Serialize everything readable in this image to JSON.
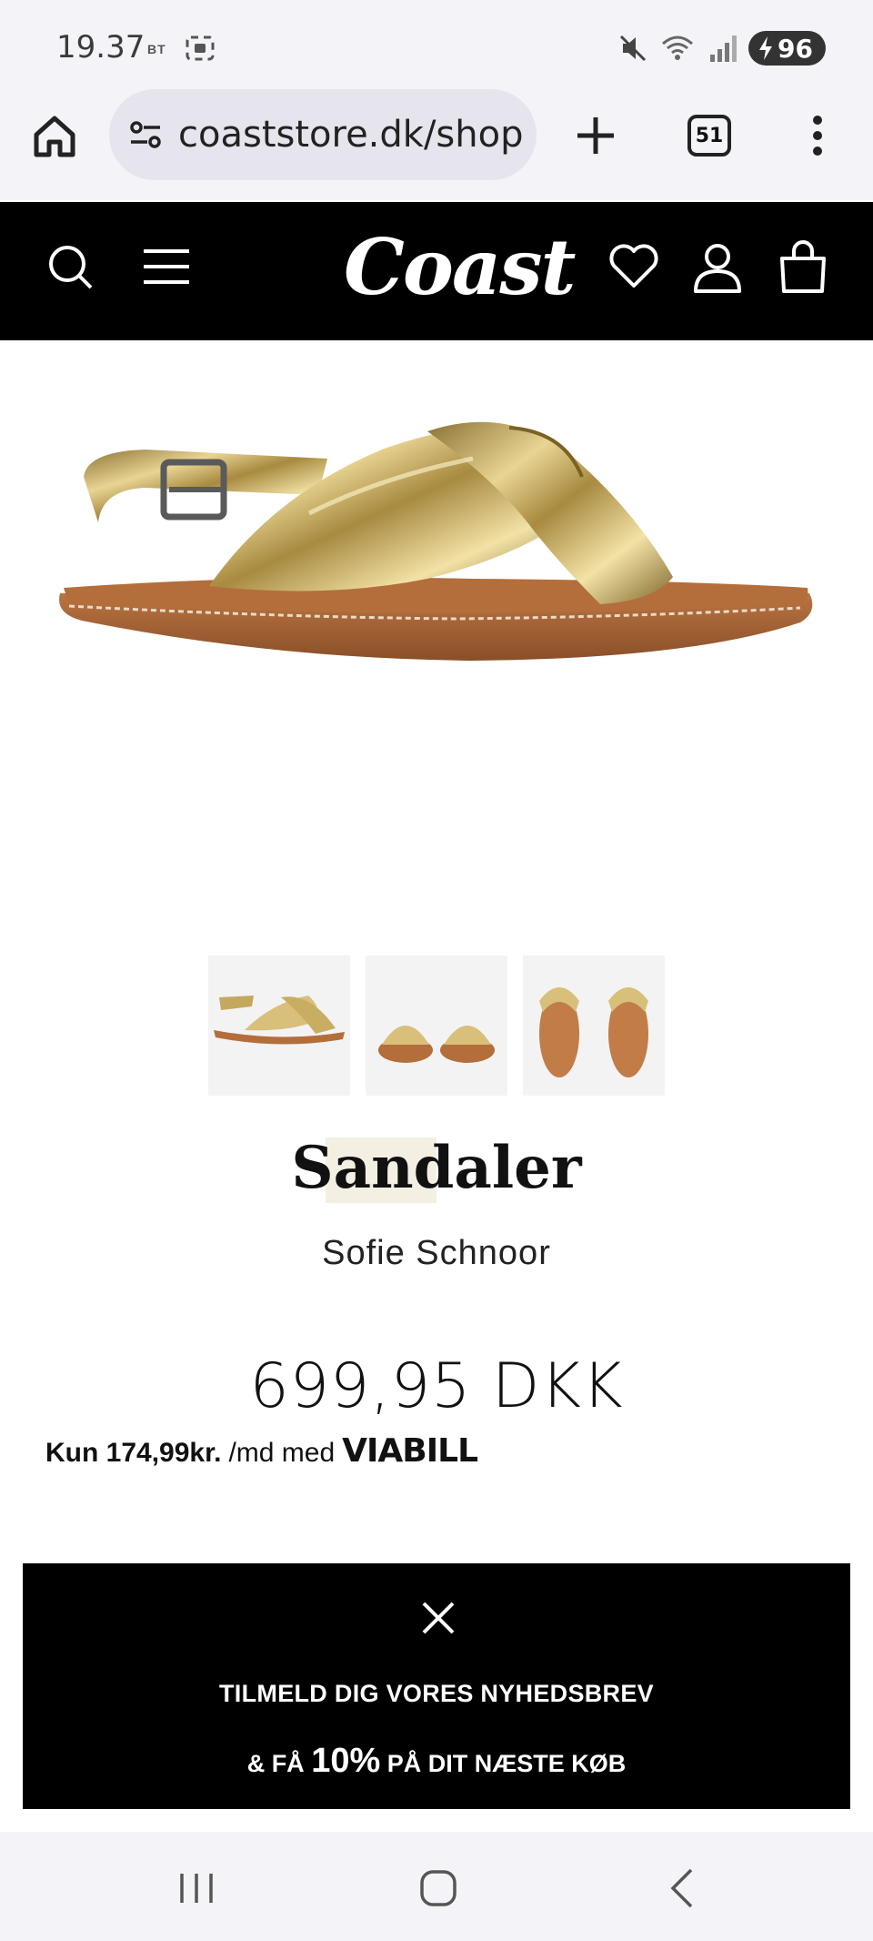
{
  "status_bar": {
    "time": "19.37",
    "bt_label": "BT",
    "battery": "96"
  },
  "browser": {
    "url": "coaststore.dk/shop",
    "tab_count": "51"
  },
  "site": {
    "logo": "Coast"
  },
  "product": {
    "title": "Sandaler",
    "brand": "Sofie Schnoor",
    "price": "699,95 DKK",
    "installment_bold": "Kun 174,99kr.",
    "installment_text": "/md med",
    "installment_provider": "VIABILL"
  },
  "newsletter": {
    "line1": "TILMELD DIG VORES NYHEDSBREV",
    "line2_prefix": "& FÅ",
    "line2_highlight": "10%",
    "line2_suffix": "PÅ DIT NÆSTE KØB"
  }
}
